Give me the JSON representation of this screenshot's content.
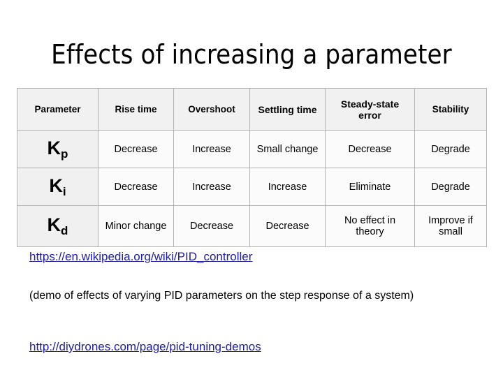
{
  "slide": {
    "title": "Effects of increasing a parameter"
  },
  "table": {
    "headers": [
      "Parameter",
      "Rise time",
      "Overshoot",
      "Settling time",
      "Steady-state error",
      "Stability"
    ],
    "rows": [
      {
        "parameter_base": "K",
        "parameter_sub": "p",
        "rise_time": "Decrease",
        "overshoot": "Increase",
        "settling_time": "Small change",
        "steady_state_error": "Decrease",
        "stability": "Degrade"
      },
      {
        "parameter_base": "K",
        "parameter_sub": "i",
        "rise_time": "Decrease",
        "overshoot": "Increase",
        "settling_time": "Increase",
        "steady_state_error": "Eliminate",
        "stability": "Degrade"
      },
      {
        "parameter_base": "K",
        "parameter_sub": "d",
        "rise_time": "Minor change",
        "overshoot": "Decrease",
        "settling_time": "Decrease",
        "steady_state_error": "No effect in theory",
        "stability": "Improve if small"
      }
    ]
  },
  "links": {
    "wikipedia": "https://en.wikipedia.org/wiki/PID_controller",
    "diydrones": "http://diydrones.com/page/pid-tuning-demos"
  },
  "notes": {
    "demo": "(demo of effects of varying PID parameters on the step response of a system)"
  },
  "colors": {
    "link": "#20209c",
    "header_bg": "#f1f1f1",
    "param_cell_bg": "#f0f0f0",
    "cell_bg": "#fbfbfb",
    "border": "#b2b2b2",
    "text": "#000000"
  }
}
